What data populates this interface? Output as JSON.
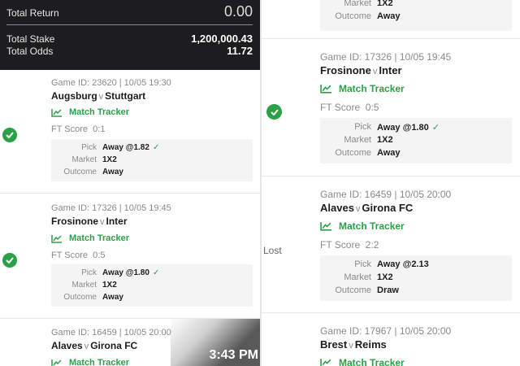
{
  "summary": {
    "total_return_label": "Total Return",
    "total_return_value": "0.00",
    "total_stake_label": "Total Stake",
    "total_stake_value": "1,200,000.43",
    "total_odds_label": "Total Odds",
    "total_odds_value": "11.72"
  },
  "labels": {
    "tracker": "Match Tracker",
    "ft_score": "FT Score",
    "pick": "Pick",
    "market": "Market",
    "outcome": "Outcome",
    "vs": "v",
    "lost": "Lost"
  },
  "left_bets": [
    {
      "game": "Game ID: 23620 | 10/05 19:30",
      "home": "Augsburg",
      "away": "Stuttgart",
      "score": "0:1",
      "pick": "Away @1.82",
      "market": "1X2",
      "outcome": "Away",
      "status": "won"
    },
    {
      "game": "Game ID: 17326 | 10/05 19:45",
      "home": "Frosinone",
      "away": "Inter",
      "score": "0:5",
      "pick": "Away @1.80",
      "market": "1X2",
      "outcome": "Away",
      "status": "won"
    },
    {
      "game": "Game ID: 16459 | 10/05 20:00",
      "home": "Alaves",
      "away": "Girona FC"
    }
  ],
  "right_partial": {
    "market": "1X2",
    "outcome": "Away"
  },
  "right_bets": [
    {
      "game": "Game ID: 17326 | 10/05 19:45",
      "home": "Frosinone",
      "away": "Inter",
      "score": "0:5",
      "pick": "Away @1.80",
      "market": "1X2",
      "outcome": "Away",
      "status": "won"
    },
    {
      "game": "Game ID: 16459 | 10/05 20:00",
      "home": "Alaves",
      "away": "Girona FC",
      "score": "2:2",
      "pick": "Away @2.13",
      "market": "1X2",
      "outcome": "Draw",
      "status": "lost"
    },
    {
      "game": "Game ID: 17967 | 10/05 20:00",
      "home": "Brest",
      "away": "Reims"
    }
  ],
  "clock": "3:43 PM",
  "colors": {
    "accent_green": "#2aa147",
    "summary_bg": "#1d1d1f"
  },
  "icons": {
    "tracker": "line-chart-icon",
    "won": "check-circle-icon",
    "pick_ok": "checkmark-icon"
  }
}
